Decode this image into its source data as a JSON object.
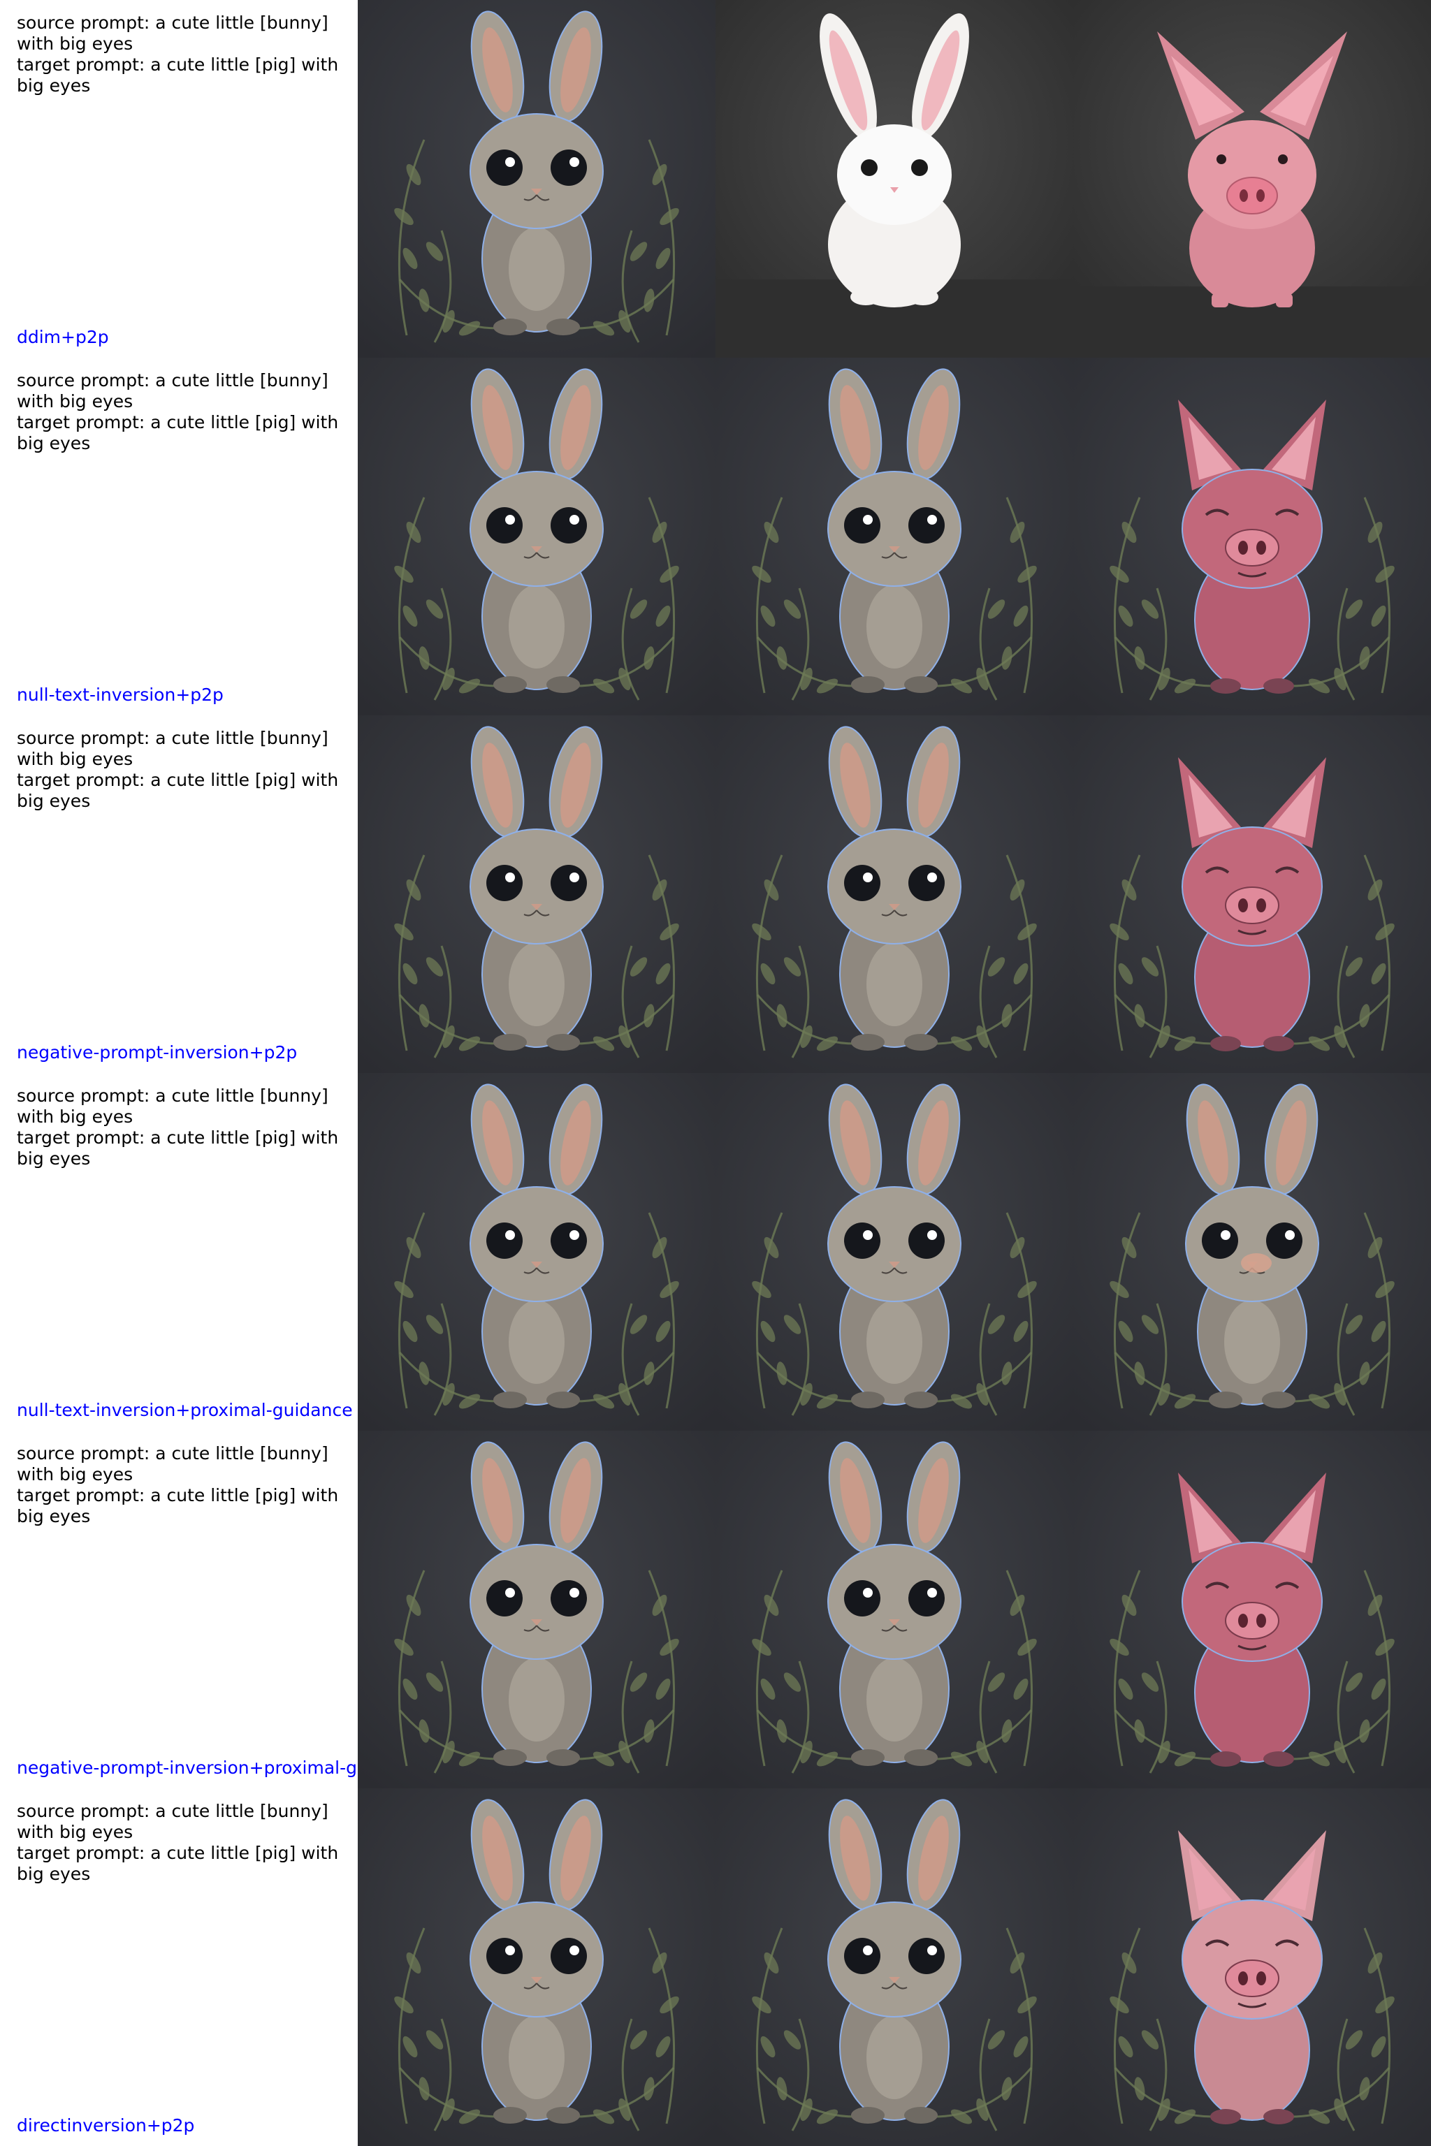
{
  "colors": {
    "method_label": "#0000ff",
    "prompt_text": "#000000",
    "illustration_bg": "#2b2c31",
    "photo_bg": "#3a3a3a",
    "bunny_fur": "#a59e93",
    "pig_pink": "#d98a98",
    "pig_dark_pink": "#b65d72",
    "white_bunny": "#f4f2f0",
    "leaf_green": "#6d7a55"
  },
  "rows": [
    {
      "source_prompt": "source prompt: a cute little [bunny] with big eyes",
      "target_prompt": "target prompt: a cute little [pig] with big eyes",
      "method": "ddim+p2p",
      "images": [
        {
          "subject": "illustrated-bunny",
          "icon": "bunny-illustration-icon"
        },
        {
          "subject": "white-bunny-photo",
          "icon": "bunny-photo-icon"
        },
        {
          "subject": "pig-photo",
          "icon": "pig-photo-icon"
        }
      ]
    },
    {
      "source_prompt": "source prompt: a cute little [bunny] with big eyes",
      "target_prompt": "target prompt: a cute little [pig] with big eyes",
      "method": "null-text-inversion+p2p",
      "images": [
        {
          "subject": "illustrated-bunny",
          "icon": "bunny-illustration-icon"
        },
        {
          "subject": "illustrated-bunny",
          "icon": "bunny-illustration-icon"
        },
        {
          "subject": "illustrated-pig",
          "icon": "pig-illustration-icon"
        }
      ]
    },
    {
      "source_prompt": "source prompt: a cute little [bunny] with big eyes",
      "target_prompt": "target prompt: a cute little [pig] with big eyes",
      "method": "negative-prompt-inversion+p2p",
      "images": [
        {
          "subject": "illustrated-bunny",
          "icon": "bunny-illustration-icon"
        },
        {
          "subject": "illustrated-bunny",
          "icon": "bunny-illustration-icon"
        },
        {
          "subject": "illustrated-pig",
          "icon": "pig-illustration-icon"
        }
      ]
    },
    {
      "source_prompt": "source prompt: a cute little [bunny] with big eyes",
      "target_prompt": "target prompt: a cute little [pig] with big eyes",
      "method": "null-text-inversion+proximal-guidance",
      "images": [
        {
          "subject": "illustrated-bunny",
          "icon": "bunny-illustration-icon"
        },
        {
          "subject": "illustrated-bunny",
          "icon": "bunny-illustration-icon"
        },
        {
          "subject": "illustrated-bunny-partial-edit",
          "icon": "bunny-illustration-icon"
        }
      ]
    },
    {
      "source_prompt": "source prompt: a cute little [bunny] with big eyes",
      "target_prompt": "target prompt: a cute little [pig] with big eyes",
      "method": "negative-prompt-inversion+proximal-g",
      "images": [
        {
          "subject": "illustrated-bunny",
          "icon": "bunny-illustration-icon"
        },
        {
          "subject": "illustrated-bunny",
          "icon": "bunny-illustration-icon"
        },
        {
          "subject": "illustrated-pig",
          "icon": "pig-illustration-icon"
        }
      ]
    },
    {
      "source_prompt": "source prompt: a cute little [bunny] with big eyes",
      "target_prompt": "target prompt: a cute little [pig] with big eyes",
      "method": "directinversion+p2p",
      "images": [
        {
          "subject": "illustrated-bunny",
          "icon": "bunny-illustration-icon"
        },
        {
          "subject": "illustrated-bunny",
          "icon": "bunny-illustration-icon"
        },
        {
          "subject": "illustrated-pig-light",
          "icon": "pig-illustration-icon"
        }
      ]
    }
  ]
}
